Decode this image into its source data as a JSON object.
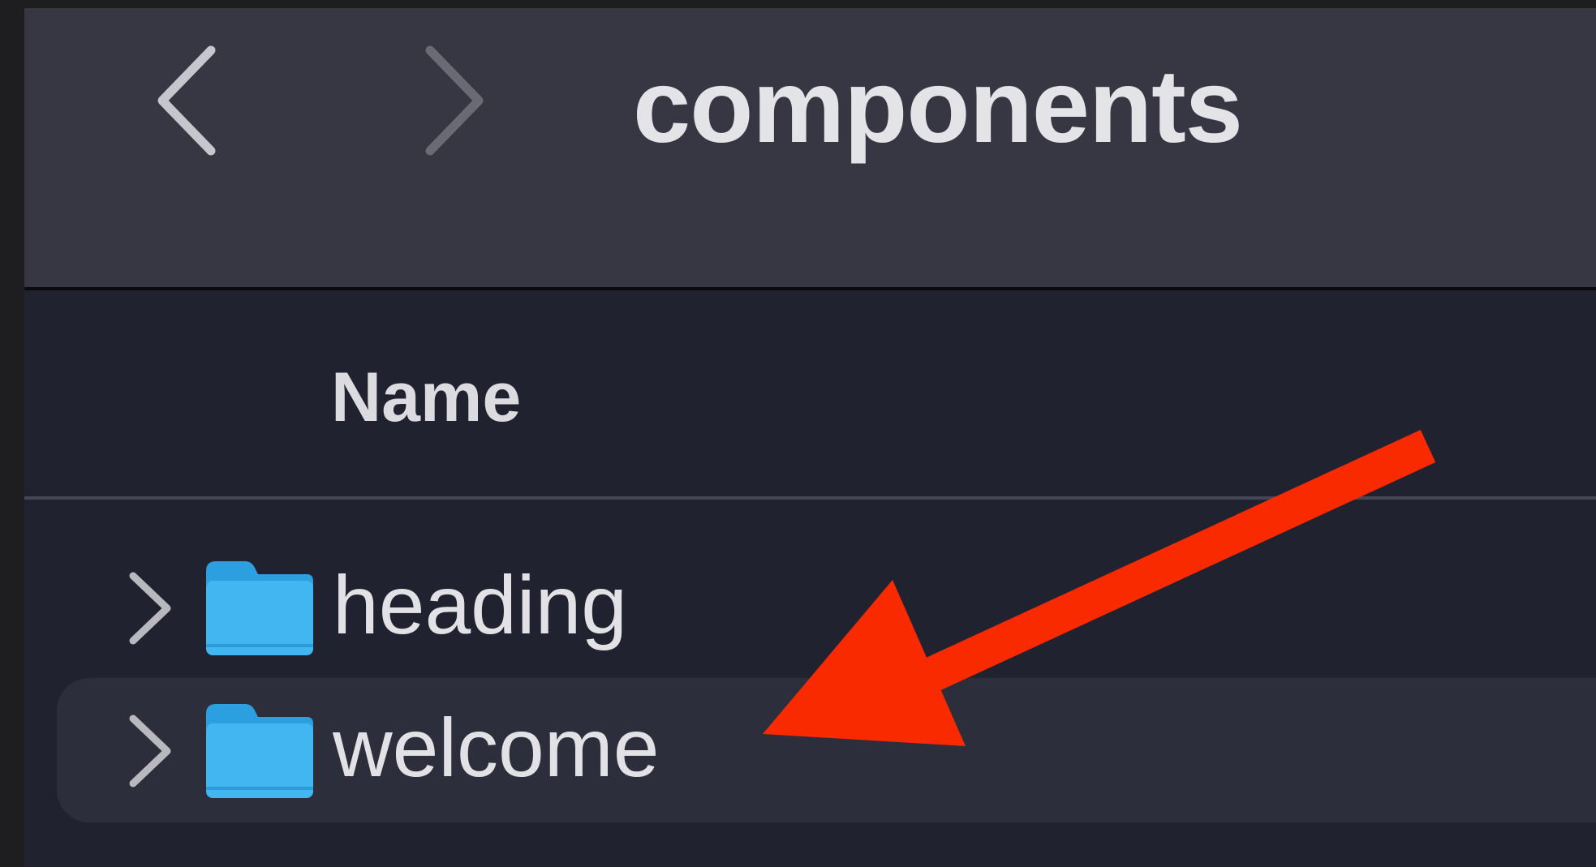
{
  "window": {
    "title": "components"
  },
  "toolbar": {
    "back_icon": "chevron-left-icon",
    "forward_icon": "chevron-right-icon"
  },
  "list": {
    "columns": [
      {
        "label": "Name"
      }
    ],
    "rows": [
      {
        "name": "heading",
        "kind": "folder",
        "selected": false
      },
      {
        "name": "welcome",
        "kind": "folder",
        "selected": true
      }
    ]
  },
  "colors": {
    "toolbar_bg": "#373743",
    "list_bg": "#212230",
    "selected_row_bg": "#2d2e3b",
    "folder_blue": "#3eb4ee",
    "annotation_arrow": "#fa2a00"
  }
}
